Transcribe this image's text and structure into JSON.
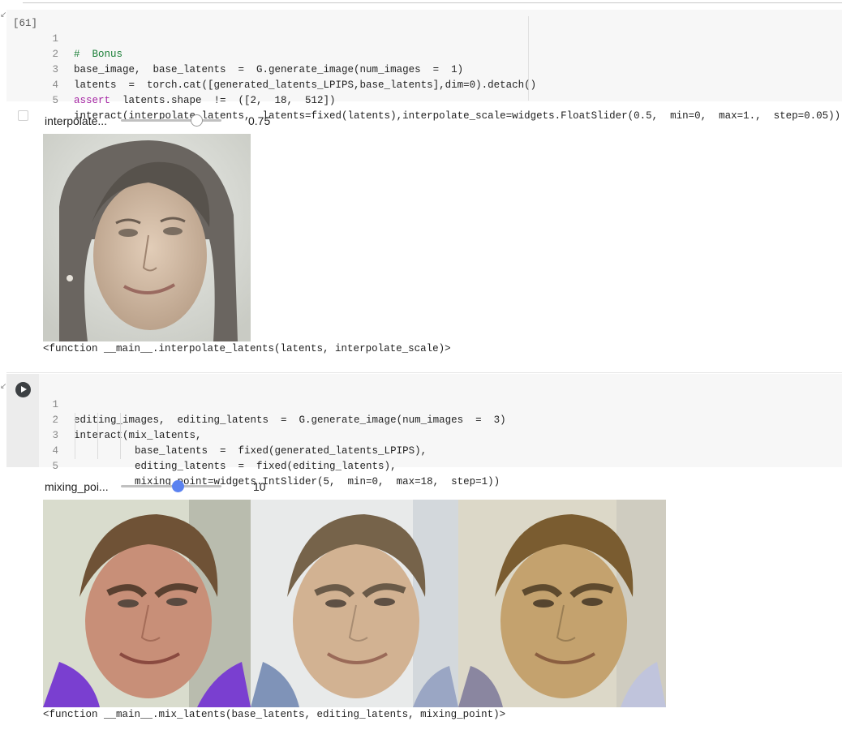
{
  "cell1": {
    "execution_count": "[61]",
    "lines": [
      {
        "n": "1",
        "text": "#  Bonus"
      },
      {
        "n": "2",
        "text": "base_image,  base_latents  =  G.generate_image(num_images  =  1)"
      },
      {
        "n": "3",
        "text": "latents  =  torch.cat([generated_latents_LPIPS,base_latents],dim=0).detach()"
      },
      {
        "n": "4",
        "text": "assert  latents.shape  !=  ([2,  18,  512])"
      },
      {
        "n": "5",
        "text": "interact(interpolate_latents,  latents=fixed(latents),interpolate_scale=widgets.FloatSlider(0.5,  min=0,  max=1.,  step=0.05))"
      }
    ],
    "widget": {
      "label": "interpolate...",
      "value": "0.75",
      "fraction": 0.75
    },
    "output_text": "<function __main__.interpolate_latents(latents, interpolate_scale)>",
    "image_alt": "interpolated face image"
  },
  "cell2": {
    "lines": [
      {
        "n": "1",
        "text": "editing_images,  editing_latents  =  G.generate_image(num_images  =  3)"
      },
      {
        "n": "2",
        "text": "interact(mix_latents,"
      },
      {
        "n": "3",
        "text": "          base_latents  =  fixed(generated_latents_LPIPS),"
      },
      {
        "n": "4",
        "text": "          editing_latents  =  fixed(editing_latents),"
      },
      {
        "n": "5",
        "text": "          mixing_point=widgets.IntSlider(5,  min=0,  max=18,  step=1))"
      }
    ],
    "widget": {
      "label": "mixing_poi...",
      "value": "10",
      "min": 0,
      "max": 18
    },
    "output_text": "<function __main__.mix_latents(base_latents, editing_latents, mixing_point)>",
    "images": [
      "mixed face 1",
      "mixed face 2",
      "mixed face 3"
    ]
  },
  "colors": {
    "accent": "#5b82f0",
    "keyword": "#a626a4",
    "comment": "#1a7f37",
    "number": "#098658"
  }
}
